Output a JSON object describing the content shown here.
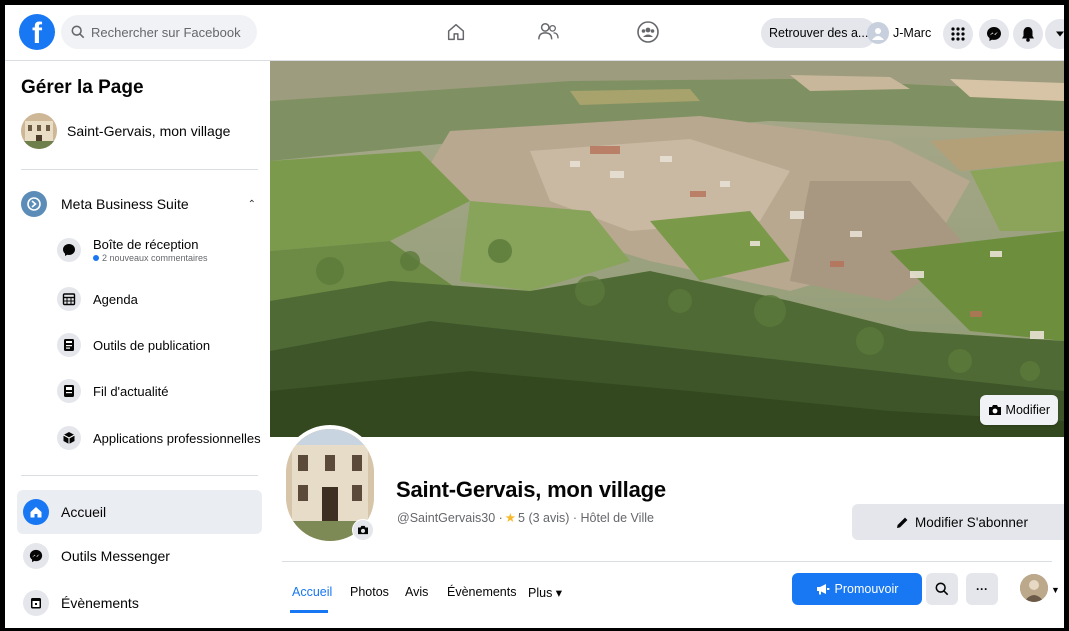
{
  "topbar": {
    "search_placeholder": "Rechercher sur Facebook",
    "find_friends_label": "Retrouver des a...",
    "profile_name": "J-Marc"
  },
  "sidebar": {
    "title": "Gérer la Page",
    "page_name": "Saint-Gervais, mon village",
    "business_suite": "Meta Business Suite",
    "sub_items": [
      {
        "label": "Boîte de réception",
        "note": "2 nouveaux commentaires",
        "icon": "inbox-icon"
      },
      {
        "label": "Agenda",
        "icon": "calendar-icon"
      },
      {
        "label": "Outils de publication",
        "icon": "publishing-tools-icon"
      },
      {
        "label": "Fil d'actualité",
        "icon": "news-feed-icon"
      },
      {
        "label": "Applications professionnelles",
        "icon": "business-apps-icon"
      }
    ],
    "main_items": [
      {
        "label": "Accueil",
        "icon": "home-icon",
        "active": true
      },
      {
        "label": "Outils Messenger",
        "icon": "messenger-icon"
      },
      {
        "label": "Évènements",
        "icon": "events-icon"
      }
    ]
  },
  "cover": {
    "edit_label": "Modifier"
  },
  "profile": {
    "name": "Saint-Gervais, mon village",
    "handle": "@SaintGervais30 · ",
    "rating": "5 (3 avis)",
    "category": " · Hôtel de Ville",
    "edit_follow_label": "Modifier S'abonner"
  },
  "tabs": [
    {
      "label": "Accueil",
      "active": true
    },
    {
      "label": "Photos"
    },
    {
      "label": "Avis"
    },
    {
      "label": "Évènements"
    },
    {
      "label": "Plus ▾"
    }
  ],
  "actions": {
    "promote_label": "Promouvoir",
    "more_label": "···"
  },
  "colors": {
    "accent": "#1877f2",
    "background": "#f0f2f5",
    "star": "#f7b928"
  }
}
